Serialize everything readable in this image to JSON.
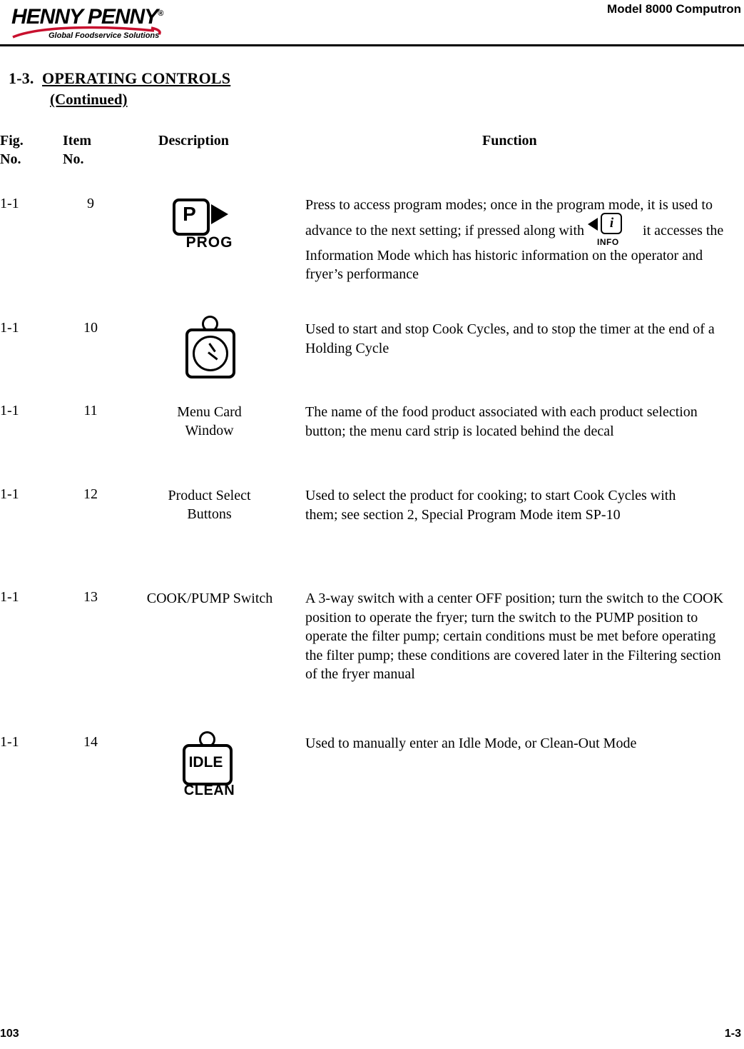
{
  "header": {
    "logo_text": "HENNY PENNY",
    "logo_reg": "®",
    "logo_tagline": "Global Foodservice Solutions",
    "model_title": "Model 8000 Computron"
  },
  "section": {
    "number": "1-3.",
    "title": "OPERATING CONTROLS",
    "continued": "(Continued)"
  },
  "columns": {
    "fig": "Fig.",
    "fig2": "No.",
    "item": "Item",
    "item2": "No.",
    "description": "Description",
    "function": "Function"
  },
  "rows": [
    {
      "fig": "1-1",
      "item": "9",
      "description": "",
      "icon": "prog-key-icon",
      "icon_label": "PROG",
      "icon_letter": "P",
      "function_part1": "Press to access program modes; once in the program mode, it is used to advance to the next setting; if pressed along with",
      "inline_icon_label": "INFO",
      "function_part2": "it accesses the Information Mode which has historic information on the operator and fryer’s performance"
    },
    {
      "fig": "1-1",
      "item": "10",
      "description": "",
      "icon": "cook-cycle-timer-icon",
      "function": "Used to start and stop Cook Cycles, and to stop the timer at the end of a Holding Cycle"
    },
    {
      "fig": "1-1",
      "item": "11",
      "description": "Menu Card\nWindow",
      "icon": "",
      "function": "The name of the food product associated with each product selection button; the menu card strip is located behind the decal"
    },
    {
      "fig": "1-1",
      "item": "12",
      "description": "Product Select\nButtons",
      "icon": "",
      "function": "Used to select the product for cooking; to start Cook Cycles with them; see section 2, Special Program Mode item SP-10"
    },
    {
      "fig": "1-1",
      "item": "13",
      "description": "COOK/PUMP Switch",
      "icon": "",
      "function": "A 3-way switch with a center OFF position; turn the switch to the COOK position to operate the fryer; turn the switch to the PUMP position to operate the filter pump; certain conditions must be met before operating the filter pump; these conditions are covered later in the Filtering section of the fryer manual"
    },
    {
      "fig": "1-1",
      "item": "14",
      "description": "",
      "icon": "idle-clean-key-icon",
      "icon_label": "IDLE",
      "icon_sublabel": "CLEAN",
      "function": "Used to manually enter an Idle Mode, or Clean-Out Mode"
    }
  ],
  "footer": {
    "left": "103",
    "right": "1-3"
  }
}
